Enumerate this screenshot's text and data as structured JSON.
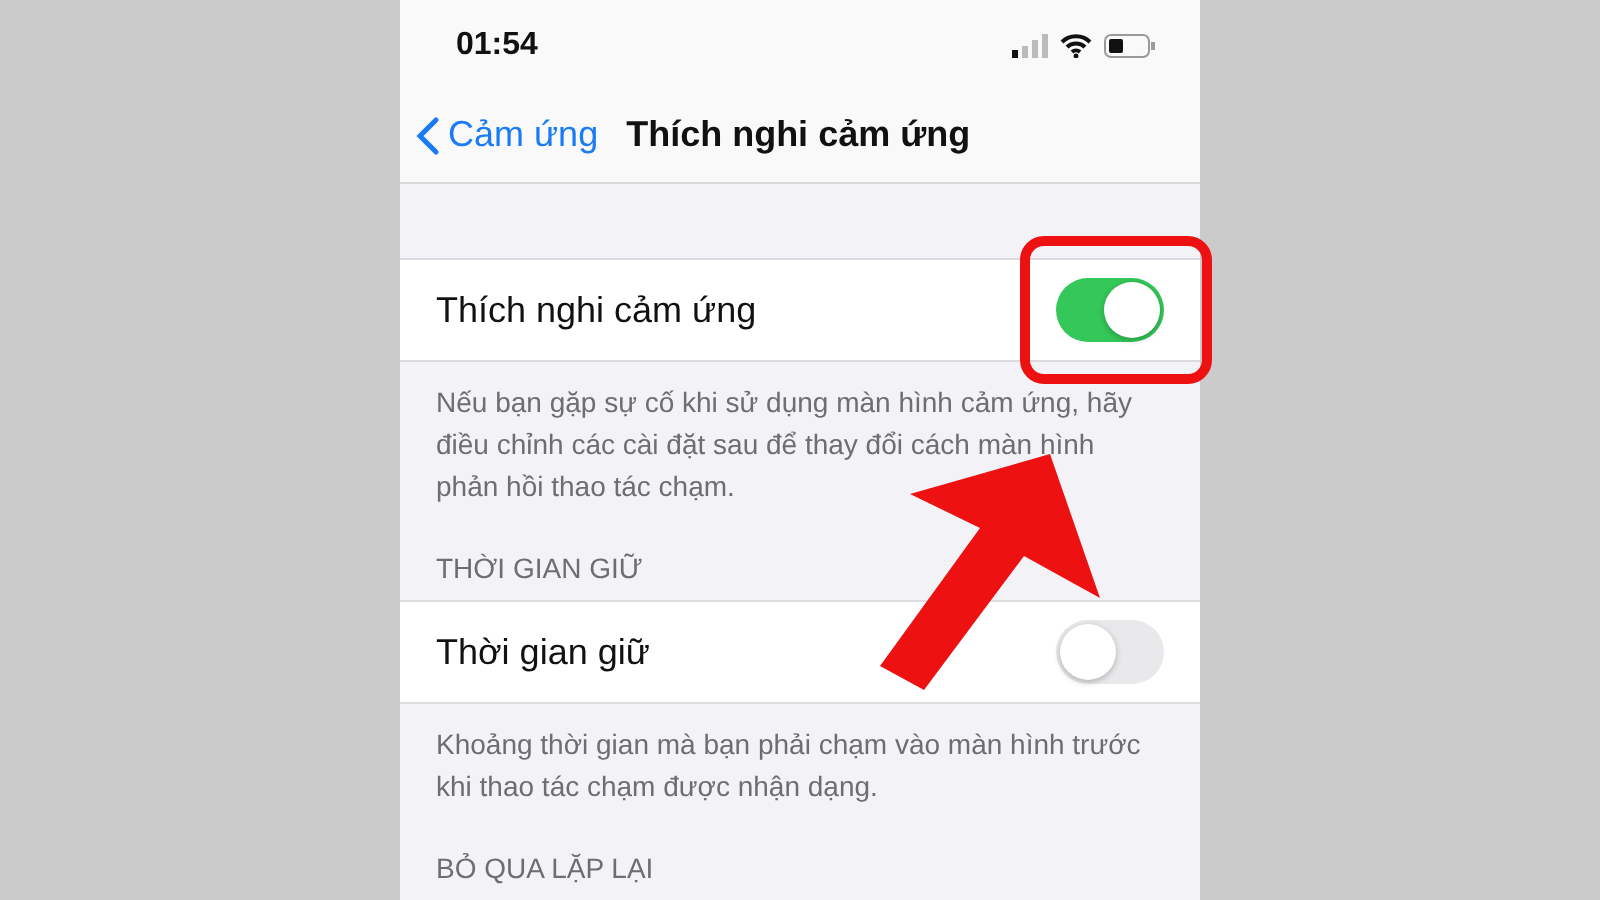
{
  "status_bar": {
    "time": "01:54"
  },
  "nav": {
    "back_label": "Cảm ứng",
    "title": "Thích nghi cảm ứng"
  },
  "sections": [
    {
      "rows": [
        {
          "label": "Thích nghi cảm ứng",
          "on": true,
          "highlighted": true
        }
      ],
      "footer": "Nếu bạn gặp sự cố khi sử dụng màn hình cảm ứng, hãy điều chỉnh các cài đặt sau để thay đổi cách màn hình phản hồi thao tác chạm."
    },
    {
      "header": "THỜI GIAN GIỮ",
      "rows": [
        {
          "label": "Thời gian giữ",
          "on": false,
          "highlighted": false
        }
      ],
      "footer": "Khoảng thời gian mà bạn phải chạm vào màn hình trước khi thao tác chạm được nhận dạng."
    },
    {
      "header": "BỎ QUA LẶP LẠI"
    }
  ]
}
